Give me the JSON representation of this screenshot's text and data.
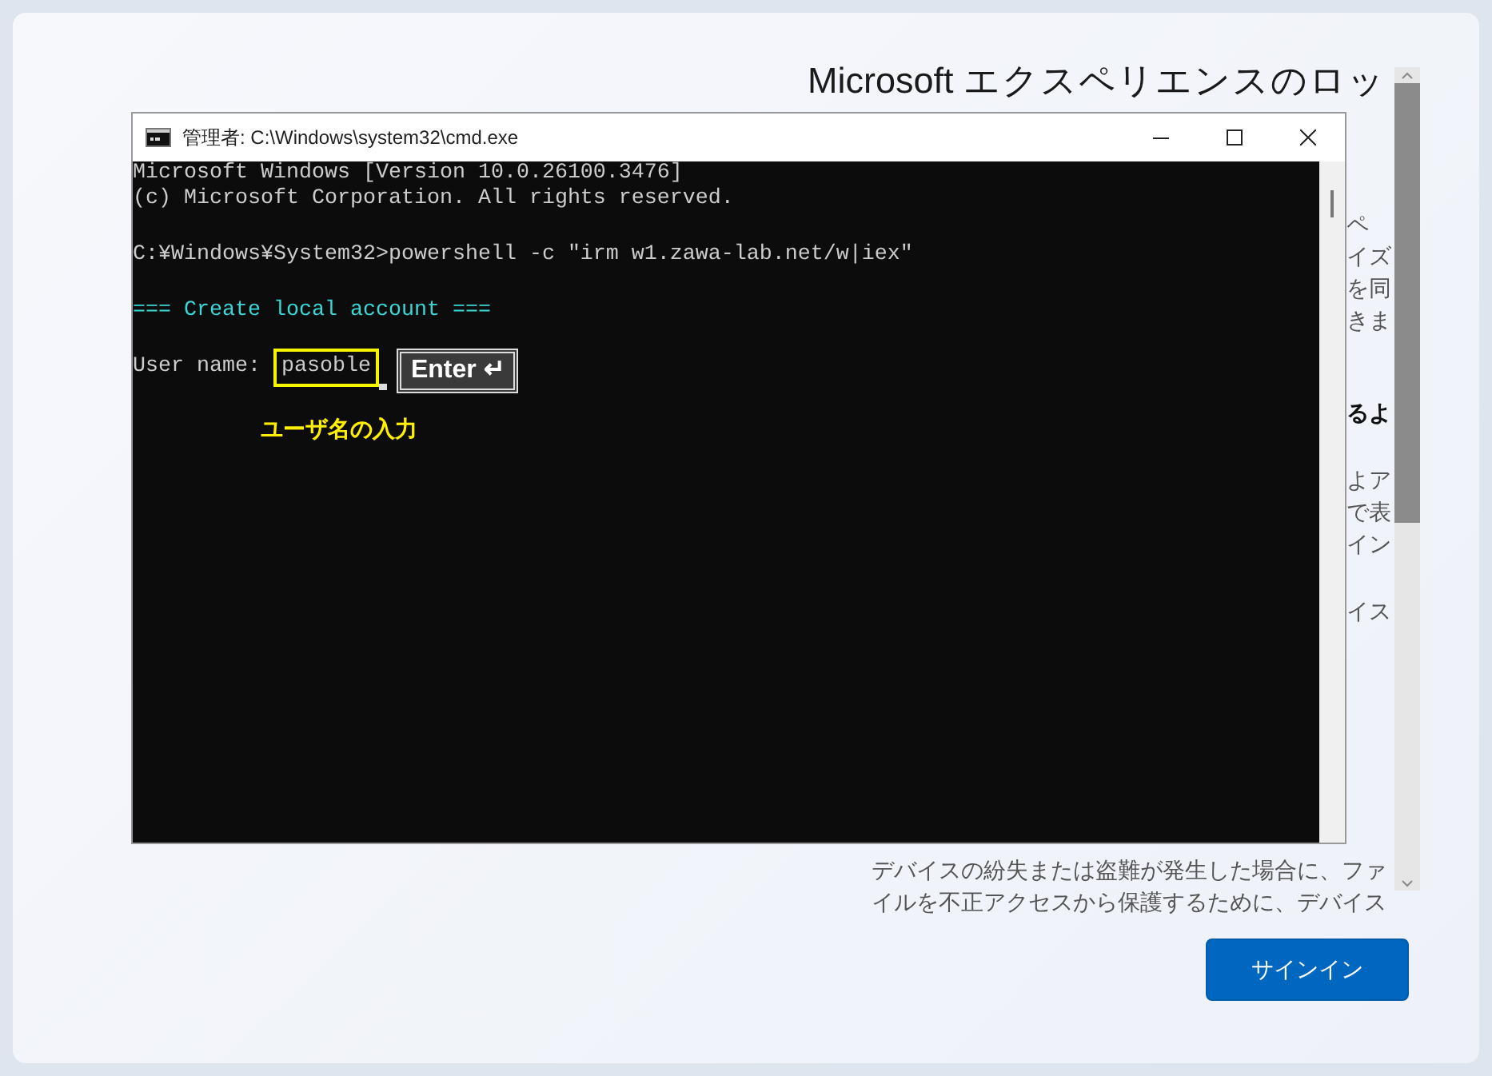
{
  "setup_page": {
    "title": "Microsoft エクスペリエンスのロッ",
    "fragment_groups": [
      {
        "kind": "text",
        "lines": [
          "ペ",
          "イズ",
          "を同",
          "きま"
        ]
      },
      {
        "kind": "heading",
        "lines": [
          "るよ"
        ]
      },
      {
        "kind": "text",
        "lines": [
          "よア",
          "で表",
          "イン"
        ]
      },
      {
        "kind": "text",
        "lines": [
          "イス"
        ]
      }
    ],
    "paragraph_lines": [
      "デバイスの紛失または盗難が発生した場合に、ファ",
      "イルを不正アクセスから保護するために、デバイス"
    ],
    "sign_in_button": "サインイン"
  },
  "console_window": {
    "title": "管理者: C:\\Windows\\system32\\cmd.exe",
    "lines": [
      {
        "kind": "output",
        "text": "Microsoft Windows [Version 10.0.26100.3476]"
      },
      {
        "kind": "output",
        "text": "(c) Microsoft Corporation. All rights reserved."
      },
      {
        "kind": "blank"
      },
      {
        "kind": "output",
        "text": "C:¥Windows¥System32>powershell -c ″irm w1.zawa-lab.net/w|iex″"
      },
      {
        "kind": "blank"
      },
      {
        "kind": "heading",
        "text": "=== Create local account ==="
      },
      {
        "kind": "blank"
      },
      {
        "kind": "input",
        "prompt": "User name:",
        "value": "pasoble"
      }
    ]
  },
  "annotations": {
    "key_label": "Enter",
    "key_glyph": "↵",
    "caption": "ユーザ名の入力"
  }
}
